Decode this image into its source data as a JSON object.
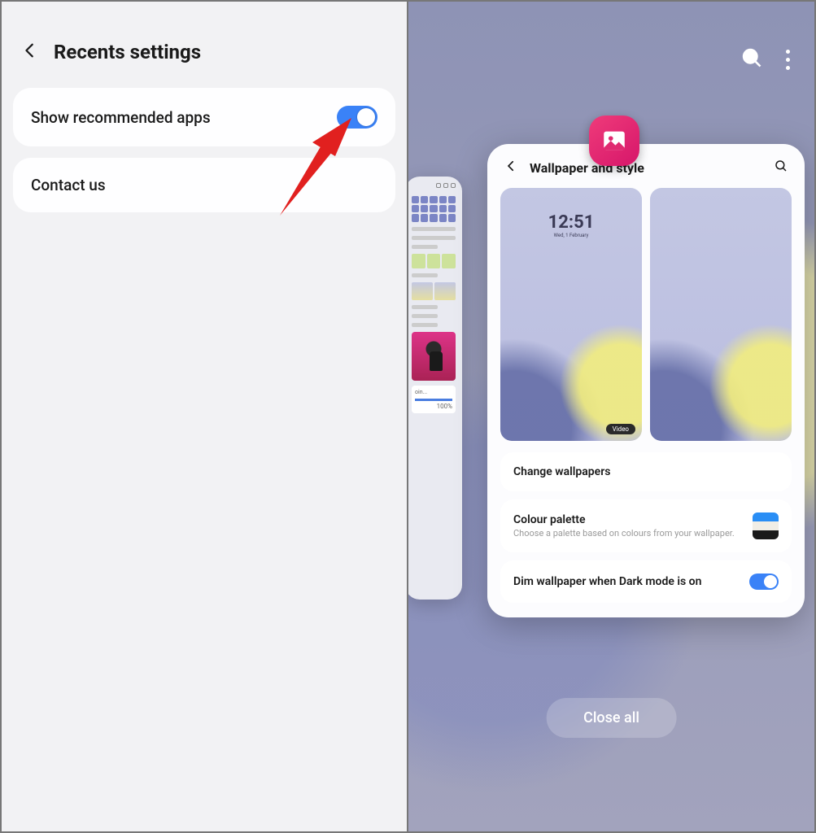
{
  "left": {
    "title": "Recents settings",
    "show_rec": "Show recommended apps",
    "contact": "Contact us"
  },
  "right": {
    "card_title": "Wallpaper and style",
    "clock_time": "12:51",
    "clock_date": "Wed, 1 February",
    "video_tag": "Video",
    "change": "Change wallpapers",
    "palette_t": "Colour palette",
    "palette_s": "Choose a palette based on colours from your wallpaper.",
    "dim": "Dim wallpaper when Dark mode is on",
    "close": "Close all",
    "peek_dl": "oin...",
    "peek_pct": "100%",
    "swatch": [
      "#2a8ef5",
      "#f1eee6",
      "#1a1a1a"
    ]
  }
}
